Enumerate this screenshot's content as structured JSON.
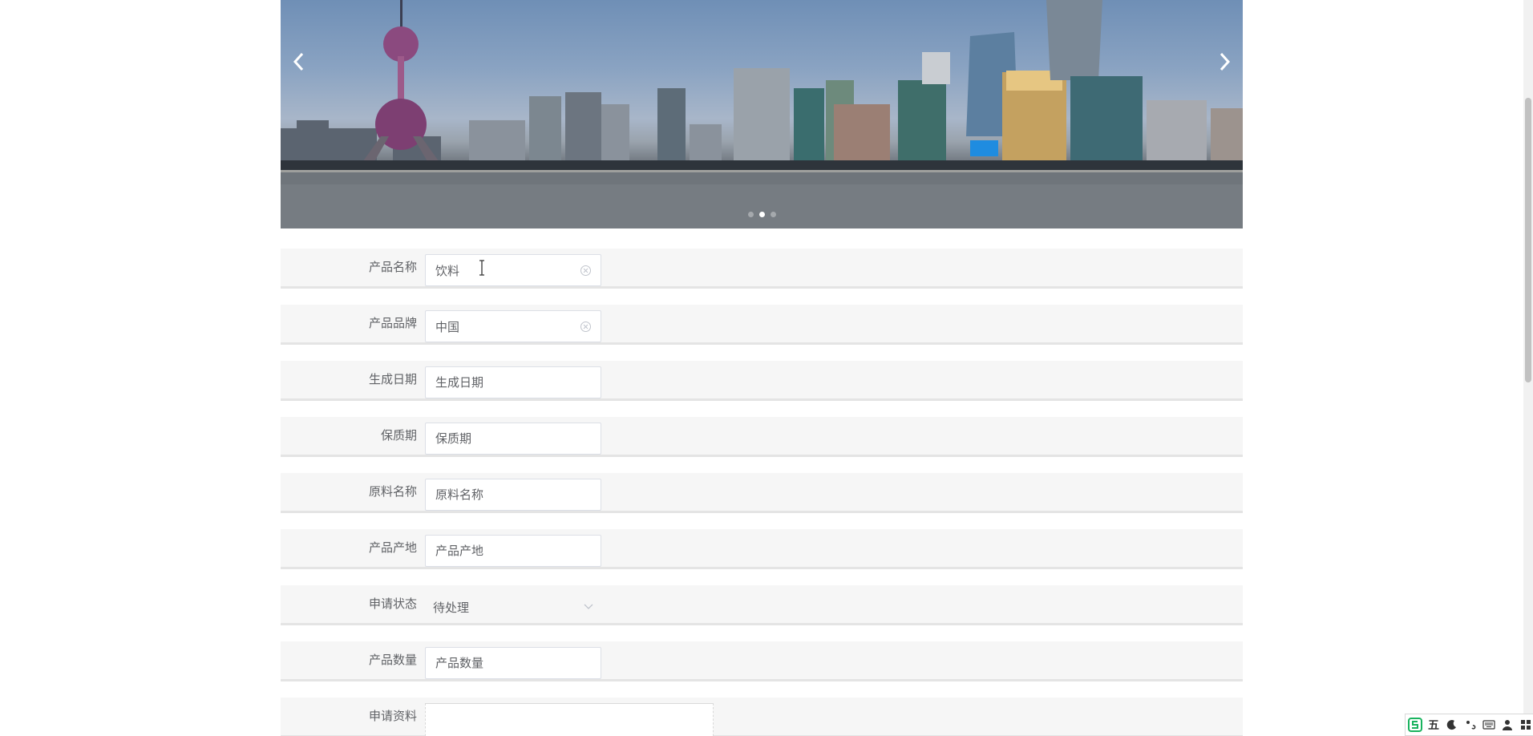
{
  "carousel": {
    "prev_label": "‹",
    "next_label": "›",
    "slide_count": 3,
    "active_slide": 2
  },
  "form": {
    "fields": [
      {
        "label": "产品名称",
        "value": "饮料",
        "placeholder": "产品名称"
      },
      {
        "label": "产品品牌",
        "value": "中国",
        "placeholder": "产品品牌"
      },
      {
        "label": "生成日期",
        "value": "",
        "placeholder": "生成日期"
      },
      {
        "label": "保质期",
        "value": "",
        "placeholder": "保质期"
      },
      {
        "label": "原料名称",
        "value": "",
        "placeholder": "原料名称"
      },
      {
        "label": "产品产地",
        "value": "",
        "placeholder": "产品产地"
      },
      {
        "label": "申请状态",
        "value": "待处理"
      },
      {
        "label": "产品数量",
        "value": "",
        "placeholder": "产品数量"
      },
      {
        "label": "申请资料"
      }
    ]
  },
  "ime": {
    "mode_label": "五"
  },
  "colors": {
    "row_bg": "#f6f6f6",
    "row_border": "#e4e4e4",
    "label_text": "#606266",
    "ime_logo": "#19b35e"
  }
}
